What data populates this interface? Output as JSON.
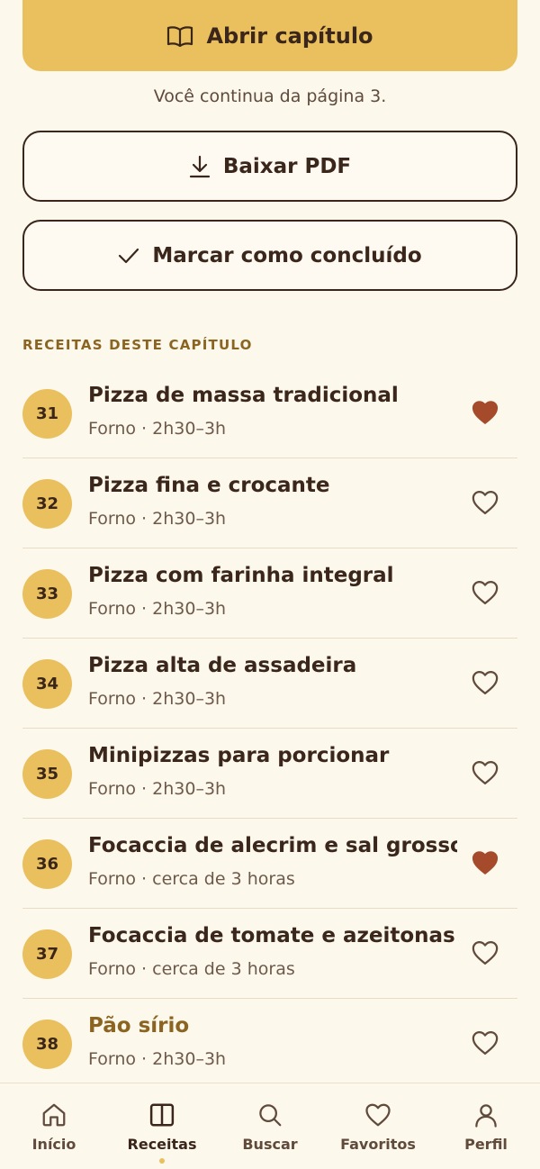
{
  "actions": {
    "open_chapter_label": "Abrir capítulo",
    "resume_text": "Você continua da página 3.",
    "download_label": "Baixar PDF",
    "mark_done_label": "Marcar como concluído"
  },
  "section": {
    "title": "RECEITAS DESTE CAPÍTULO"
  },
  "recipes": [
    {
      "number": "31",
      "title": "Pizza de massa tradicional",
      "meta": "Forno · 2h30–3h",
      "favorite": true
    },
    {
      "number": "32",
      "title": "Pizza fina e crocante",
      "meta": "Forno · 2h30–3h",
      "favorite": false
    },
    {
      "number": "33",
      "title": "Pizza com farinha integral",
      "meta": "Forno · 2h30–3h",
      "favorite": false
    },
    {
      "number": "34",
      "title": "Pizza alta de assadeira",
      "meta": "Forno · 2h30–3h",
      "favorite": false
    },
    {
      "number": "35",
      "title": "Minipizzas para porcionar",
      "meta": "Forno · 2h30–3h",
      "favorite": false
    },
    {
      "number": "36",
      "title": "Focaccia de alecrim e sal grosso",
      "meta": "Forno · cerca de 3 horas",
      "favorite": true
    },
    {
      "number": "37",
      "title": "Focaccia de tomate e azeitonas",
      "meta": "Forno · cerca de 3 horas",
      "favorite": false
    },
    {
      "number": "38",
      "title": "Pão sírio",
      "meta": "Forno · 2h30–3h",
      "favorite": false
    }
  ],
  "nav": {
    "items": [
      {
        "label": "Início",
        "icon": "home-icon",
        "active": false
      },
      {
        "label": "Receitas",
        "icon": "book-icon",
        "active": true
      },
      {
        "label": "Buscar",
        "icon": "search-icon",
        "active": false
      },
      {
        "label": "Favoritos",
        "icon": "heart-icon",
        "active": false
      },
      {
        "label": "Perfil",
        "icon": "user-icon",
        "active": false
      }
    ]
  },
  "colors": {
    "accent": "#eac05e",
    "accent_text": "#8a6420",
    "favorite": "#a54a2a",
    "text": "#3a261a",
    "background": "#fdf8ec"
  }
}
